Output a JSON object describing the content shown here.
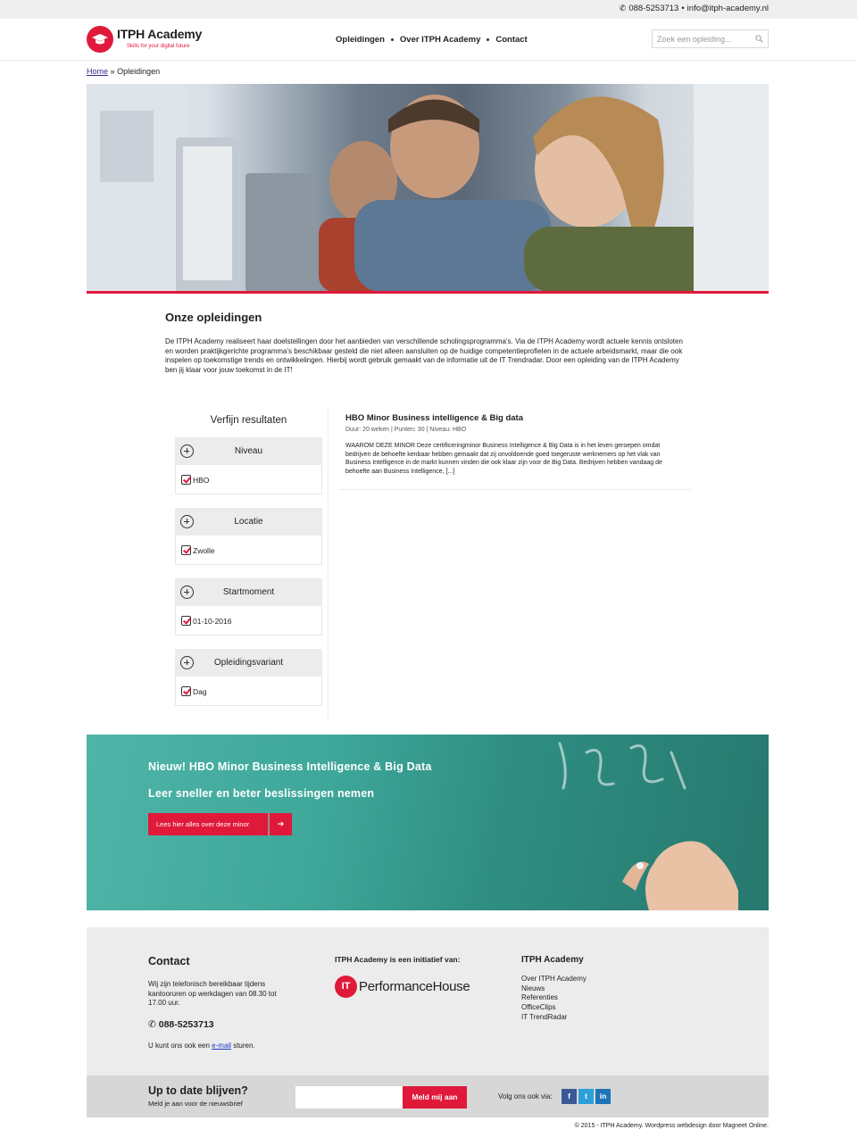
{
  "topbar": {
    "phone": "088-5253713",
    "separator": "•",
    "email": "info@itph-academy.nl"
  },
  "logo": {
    "name": "ITPH Academy",
    "tagline": "Skills for your digital future"
  },
  "nav": {
    "items": [
      "Opleidingen",
      "Over ITPH Academy",
      "Contact"
    ]
  },
  "search": {
    "placeholder": "Zoek een opleiding..."
  },
  "breadcrumb": {
    "home": "Home",
    "separator": "»",
    "current": "Opleidingen"
  },
  "intro": {
    "title": "Onze opleidingen",
    "text": "De ITPH Academy realiseert haar doelstellingen door het aanbieden van verschillende scholingsprogramma's. Via de ITPH Academy wordt actuele kennis ontsloten en worden praktijkgerichte programma's beschikbaar gesteld die niet alleen aansluiten op de huidige competentieprofielen in de actuele arbeidsmarkt, maar die ook inspelen op toekomstige trends en ontwikkelingen. Hierbij wordt gebruik gemaakt van de informatie uit de IT Trendradar. Door een opleiding van de ITPH Academy ben jij klaar voor jouw toekomst in de IT!"
  },
  "filters": {
    "title": "Verfijn resultaten",
    "facets": [
      {
        "label": "Niveau",
        "option": "HBO"
      },
      {
        "label": "Locatie",
        "option": "Zwolle"
      },
      {
        "label": "Startmoment",
        "option": "01-10-2016"
      },
      {
        "label": "Opleidingsvariant",
        "option": "Dag"
      }
    ]
  },
  "result": {
    "title": "HBO Minor Business intelligence & Big data",
    "meta": "Duur: 20 weken | Punten: 30 | Niveau: HBO",
    "text": "WAAROM DEZE MINOR Deze certificeringminor Business Intelligence & Big Data is in het leven geroepen omdat bedrijven de behoefte kenbaar hebben gemaakt dat zij onvoldoende goed toegeruste werknemers op het vlak van Business Intelligence in de markt kunnen vinden die ook klaar zijn voor de Big Data. Bedrijven hebben vandaag de behoefte aan Business Intelligence, [...]"
  },
  "promo": {
    "title": "Nieuw! HBO Minor Business Intelligence & Big Data",
    "subtitle": "Leer sneller en beter beslissingen nemen",
    "button": "Lees hier alles over deze minor",
    "button_icon": "➔"
  },
  "footer": {
    "contact_title": "Contact",
    "contact_text": "Wij zijn telefonisch bereikbaar tijdens kantooruren op werkdagen van 08.30 tot 17.00 uur.",
    "phone_icon": "✆",
    "phone": "088-5253713",
    "mail_prefix": "U kunt ons ook een",
    "mail_link": "e-mail",
    "mail_suffix": "sturen.",
    "initiative_title": "ITPH Academy is een initiatief van:",
    "ph_logo_mark": "IT",
    "ph_logo_text": "PerformanceHouse",
    "links_title": "ITPH Academy",
    "links": [
      "Over ITPH Academy",
      "Nieuws",
      "Referenties",
      "OfficeClips",
      "IT TrendRadar"
    ]
  },
  "newsletter": {
    "title": "Up to date blijven?",
    "subtitle": "Meld je aan voor de nieuwsbrief",
    "button": "Meld mij aan",
    "follow": "Volg ons ook via:",
    "social": [
      {
        "icon": "facebook-icon",
        "glyph": "f",
        "color": "#3b5998"
      },
      {
        "icon": "twitter-icon",
        "glyph": "t",
        "color": "#2d9fd9"
      },
      {
        "icon": "linkedin-icon",
        "glyph": "in",
        "color": "#1d74b8"
      }
    ]
  },
  "copyright": "© 2015 - ITPH Academy. Wordpress webdesign door Magneet Online.",
  "colors": {
    "accent": "#e0193a",
    "promo": "#3ea79a",
    "footer_bg": "#ececec"
  }
}
